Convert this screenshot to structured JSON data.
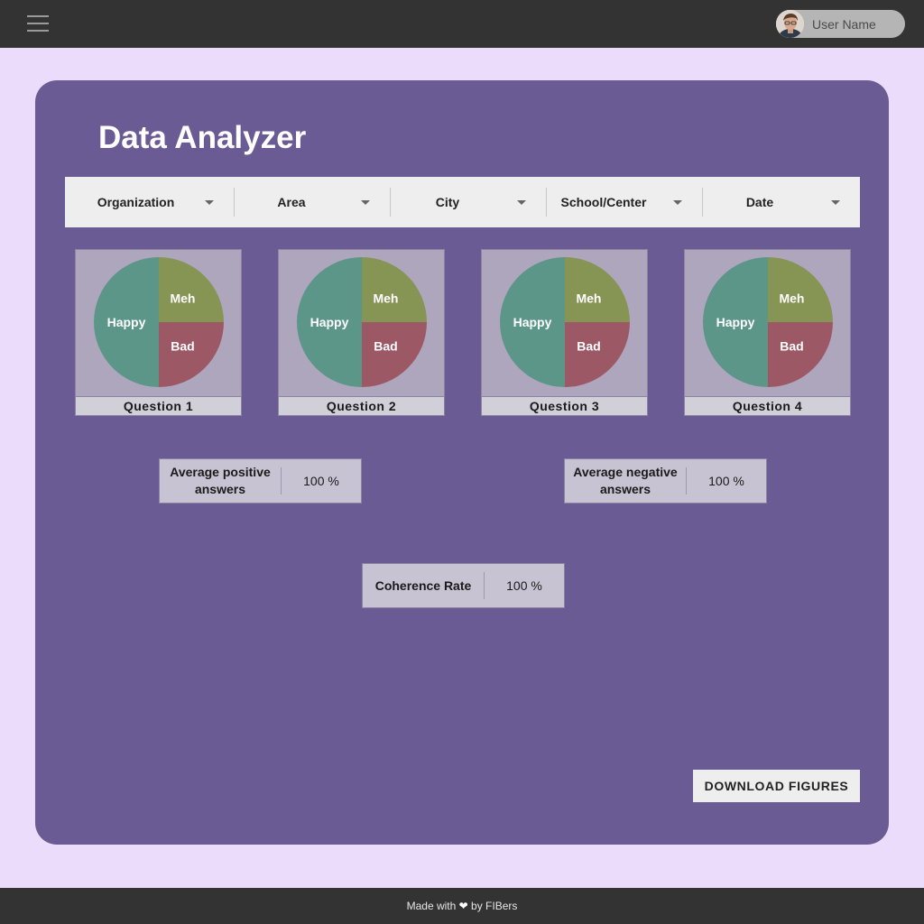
{
  "header": {
    "menu_icon": "hamburger-menu-icon",
    "user_name": "User Name"
  },
  "main": {
    "title": "Data Analyzer",
    "filters": [
      {
        "label": "Organization"
      },
      {
        "label": "Area"
      },
      {
        "label": "City"
      },
      {
        "label": "School/Center"
      },
      {
        "label": "Date"
      }
    ],
    "questions": [
      {
        "label": "Question 1"
      },
      {
        "label": "Question 2"
      },
      {
        "label": "Question 3"
      },
      {
        "label": "Question 4"
      }
    ],
    "pie": {
      "slices": [
        {
          "name": "Happy",
          "value": 50,
          "color": "#5b9688"
        },
        {
          "name": "Meh",
          "value": 25,
          "color": "#869454"
        },
        {
          "name": "Bad",
          "value": 25,
          "color": "#9c5865"
        }
      ]
    },
    "stats": {
      "positive": {
        "label": "Average positive answers",
        "value": "100 %"
      },
      "negative": {
        "label": "Average negative answers",
        "value": "100 %"
      },
      "coherence": {
        "label": "Coherence Rate",
        "value": "100 %"
      }
    },
    "download_label": "DOWNLOAD FIGURES"
  },
  "footer": {
    "text_before": "Made with",
    "heart": "❤",
    "text_after": "by FIBers"
  },
  "colors": {
    "topbar": "#333333",
    "background": "#ecdcfc",
    "card": "#6b5b95"
  }
}
